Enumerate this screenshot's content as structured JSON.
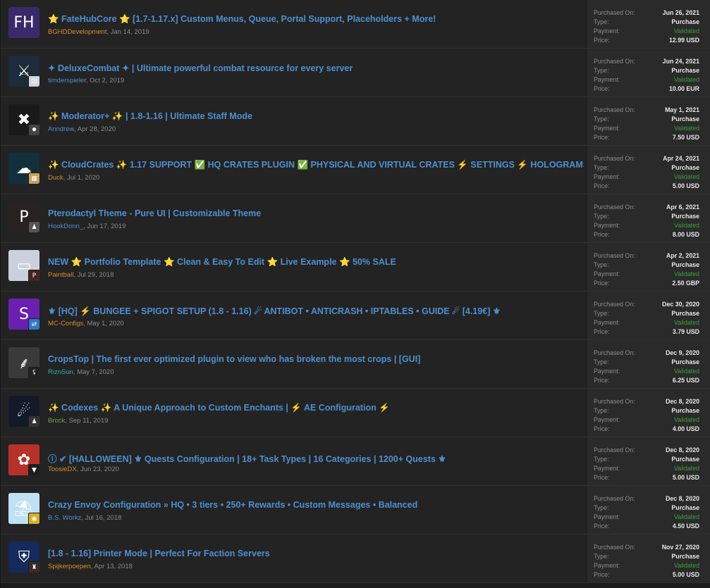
{
  "labels": {
    "purchased_on": "Purchased On:",
    "type": "Type:",
    "payment": "Payment:",
    "price": "Price:"
  },
  "colors": {
    "title": "#4e8fd0",
    "validated": "#3c9e3c",
    "author_orange": "#d98b2a",
    "author_blue": "#4e8fd0",
    "author_teal": "#2fb6a0",
    "author_green": "#6aa84f"
  },
  "purchases": [
    {
      "title": "⭐ FateHubCore ⭐ [1.7-1.17.x] Custom Menus, Queue, Portal Support, Placeholders + More!",
      "author": "BGHDDevelopment",
      "author_color": "#d98b2a",
      "date": "Jan 14, 2019",
      "icon": "fatehub-logo-icon",
      "icon_bg": "#3a2a6a",
      "icon_glyph": "FH",
      "avatar_icon": "",
      "avatar_bg": "",
      "avatar_glyph": "",
      "purchased_on": "Jun 26, 2021",
      "type": "Purchase",
      "payment": "Validated",
      "price": "12.99 USD"
    },
    {
      "title": "✦ DeluxeCombat ✦ | Ultimate powerful combat resource for every server",
      "author": "timderspieler",
      "author_color": "#4e8fd0",
      "date": "Oct 2, 2019",
      "icon": "sword-shield-icon",
      "icon_bg": "#1d2c3a",
      "icon_glyph": "⚔",
      "avatar_icon": "user-avatar-icon",
      "avatar_bg": "#cfd6e0",
      "avatar_glyph": "☺",
      "purchased_on": "Jun 24, 2021",
      "type": "Purchase",
      "payment": "Validated",
      "price": "10.00 EUR"
    },
    {
      "title": "✨ Moderator+ ✨ | 1.8-1.16 | Ultimate Staff Mode",
      "author": "Anndrew",
      "author_color": "#4e8fd0",
      "date": "Apr 28, 2020",
      "icon": "wrench-screwdriver-icon",
      "icon_bg": "#1a1a1a",
      "icon_glyph": "✖",
      "avatar_icon": "user-avatar-icon",
      "avatar_bg": "#444444",
      "avatar_glyph": "✹",
      "purchased_on": "May 1, 2021",
      "type": "Purchase",
      "payment": "Validated",
      "price": "7.50 USD"
    },
    {
      "title": "✨ CloudCrates ✨ 1.17 SUPPORT ✅ HQ CRATES PLUGIN ✅ PHYSICAL AND VIRTUAL CRATES ⚡ SETTINGS ⚡ HOLOGRAMS",
      "author": "Duck",
      "author_color": "#d98b2a",
      "date": "Jul 1, 2020",
      "icon": "cloud-crate-icon",
      "icon_bg": "#12303a",
      "icon_glyph": "☁",
      "avatar_icon": "user-avatar-icon",
      "avatar_bg": "#c9a25a",
      "avatar_glyph": "▦",
      "purchased_on": "Apr 24, 2021",
      "type": "Purchase",
      "payment": "Validated",
      "price": "5.00 USD"
    },
    {
      "title": "Pterodactyl Theme - Pure UI | Customizable Theme",
      "author": "HookDonn_",
      "author_color": "#4e8fd0",
      "date": "Jun 17, 2019",
      "icon": "pterodactyl-logo-icon",
      "icon_bg": "#2a2222",
      "icon_glyph": "P",
      "avatar_icon": "user-avatar-icon",
      "avatar_bg": "#555555",
      "avatar_glyph": "♟",
      "purchased_on": "Apr 6, 2021",
      "type": "Purchase",
      "payment": "Validated",
      "price": "8.00 USD"
    },
    {
      "title": "NEW ⭐ Portfolio Template ⭐ Clean & Easy To Edit ⭐ Live Example ⭐ 50% SALE",
      "author": "Paintball",
      "author_color": "#d98b2a",
      "date": "Jul 29, 2018",
      "icon": "monitor-icon",
      "icon_bg": "#c9d2dc",
      "icon_glyph": "▭",
      "avatar_icon": "user-avatar-icon",
      "avatar_bg": "#4a2222",
      "avatar_glyph": "P",
      "purchased_on": "Apr 2, 2021",
      "type": "Purchase",
      "payment": "Validated",
      "price": "2.50 GBP"
    },
    {
      "title": "⚜ [HQ] ⚡ BUNGEE + SPIGOT SETUP (1.8 - 1.16) ☄ ANTIBOT • ANTICRASH • IPTABLES • GUIDE ☄ [4.19€] ⚜",
      "author": "MC-Configs",
      "author_color": "#d98b2a",
      "date": "May 1, 2020",
      "icon": "s-logo-icon",
      "icon_bg": "#6a1fb0",
      "icon_glyph": "S",
      "avatar_icon": "user-avatar-icon",
      "avatar_bg": "#2f79c9",
      "avatar_glyph": "⇄",
      "purchased_on": "Dec 30, 2020",
      "type": "Purchase",
      "payment": "Validated",
      "price": "3.79 USD"
    },
    {
      "title": "CropsTop | The first ever optimized plugin to view who has broken the most crops | [GUI]",
      "author": "RiznSun",
      "author_color": "#2fb6a0",
      "date": "May 7, 2020",
      "icon": "wheat-icon",
      "icon_bg": "#3a3a3a",
      "icon_glyph": "⸙",
      "avatar_icon": "user-avatar-icon",
      "avatar_bg": "#222222",
      "avatar_glyph": "ʢ",
      "purchased_on": "Dec 9, 2020",
      "type": "Purchase",
      "payment": "Validated",
      "price": "6.25 USD"
    },
    {
      "title": "✨ Codexes ✨ A Unique Approach to Custom Enchants | ⚡ AE Configuration ⚡",
      "author": "Brock",
      "author_color": "#6aa84f",
      "date": "Sep 11, 2019",
      "icon": "comet-icon",
      "icon_bg": "#121a2a",
      "icon_glyph": "☄",
      "avatar_icon": "user-avatar-icon",
      "avatar_bg": "#333333",
      "avatar_glyph": "♟",
      "purchased_on": "Dec 8, 2020",
      "type": "Purchase",
      "payment": "Validated",
      "price": "4.00 USD"
    },
    {
      "title": "ⓘ ✔ [HALLOWEEN] ⚜ Quests Configuration | 18+ Task Types | 16 Categories | 1200+ Quests ⚜",
      "author": "ToosieDX",
      "author_color": "#d98b2a",
      "date": "Jun 23, 2020",
      "icon": "lotus-icon",
      "icon_bg": "#b8302a",
      "icon_glyph": "✿",
      "avatar_icon": "user-avatar-icon",
      "avatar_bg": "#1e1e1e",
      "avatar_glyph": "▼",
      "purchased_on": "Dec 8, 2020",
      "type": "Purchase",
      "payment": "Validated",
      "price": "5.00 USD"
    },
    {
      "title": "Crazy Envoy Configuration » HQ • 3 tiers • 250+ Rewards • Custom Messages • Balanced",
      "author": "B.S. Workz",
      "author_color": "#4e8fd0",
      "date": "Jul 16, 2018",
      "icon": "parachute-crate-icon",
      "icon_bg": "#bfe1f3",
      "icon_glyph": "⛱",
      "avatar_icon": "user-avatar-icon",
      "avatar_bg": "#d8b020",
      "avatar_glyph": "◉",
      "purchased_on": "Dec 8, 2020",
      "type": "Purchase",
      "payment": "Validated",
      "price": "4.50 USD"
    },
    {
      "title": "[1.8 - 1.16] Printer Mode | Perfect For Faction Servers",
      "author": "Spijkerpoepen",
      "author_color": "#d98b2a",
      "date": "Apr 13, 2018",
      "icon": "shield-logo-icon",
      "icon_bg": "#142a5a",
      "icon_glyph": "⛨",
      "avatar_icon": "user-avatar-icon",
      "avatar_bg": "#3a2a2a",
      "avatar_glyph": "♜",
      "purchased_on": "Nov 27, 2020",
      "type": "Purchase",
      "payment": "Validated",
      "price": "5.00 USD"
    }
  ]
}
